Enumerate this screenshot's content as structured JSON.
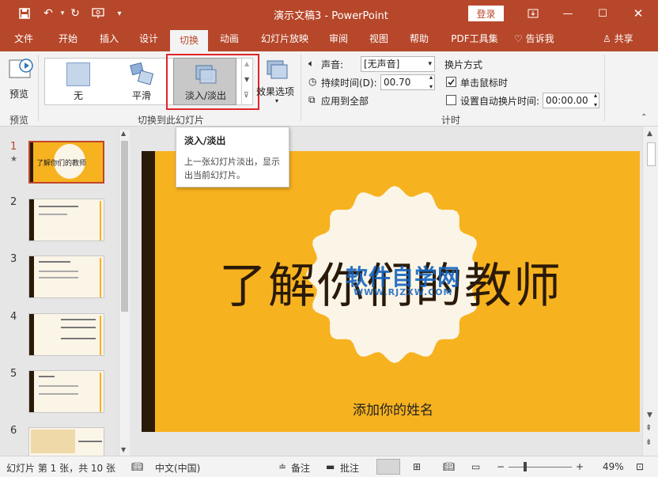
{
  "titlebar": {
    "title": "演示文稿3  -  PowerPoint",
    "login": "登录",
    "icons": [
      "save-icon",
      "undo-icon",
      "redo-icon",
      "presenter-icon",
      "customize-icon"
    ]
  },
  "tabs": [
    "文件",
    "开始",
    "插入",
    "设计",
    "切换",
    "动画",
    "幻灯片放映",
    "审阅",
    "视图",
    "帮助",
    "PDF工具集",
    "告诉我",
    "共享"
  ],
  "ribbon": {
    "preview_label": "预览",
    "preview_group": "预览",
    "transitions": [
      "无",
      "平滑",
      "淡入/淡出"
    ],
    "effect_options": "效果选项",
    "transition_group": "切换到此幻灯片",
    "sound_label": "声音:",
    "sound_value": "[无声音]",
    "duration_label": "持续时间(D):",
    "duration_value": "00.70",
    "apply_all": "应用到全部",
    "advance_title": "换片方式",
    "on_click": "单击鼠标时",
    "after_time": "设置自动换片时间:",
    "after_value": "00:00.00",
    "timing_group": "计时"
  },
  "tooltip": {
    "title": "淡入/淡出",
    "body": "上一张幻灯片淡出，显示出当前幻灯片。"
  },
  "slides": {
    "numbers": [
      "1",
      "2",
      "3",
      "4",
      "5",
      "6"
    ],
    "first_thumb_title": "了解你们的教师",
    "star": "★"
  },
  "main_slide": {
    "title": "了解你们的教师",
    "subtitle": "添加你的姓名",
    "watermark": "软件自学网",
    "watermark_url": "WWW.RJZXW.COM"
  },
  "statusbar": {
    "slide_info": "幻灯片 第 1 张，共 10 张",
    "language": "中文(中国)",
    "notes": "备注",
    "comments": "批注",
    "zoom": "49%"
  },
  "colors": {
    "accent": "#b7472a",
    "slide_bg": "#f7b21f",
    "slide_bar": "#2a1a08",
    "highlight": "#e0252b"
  }
}
